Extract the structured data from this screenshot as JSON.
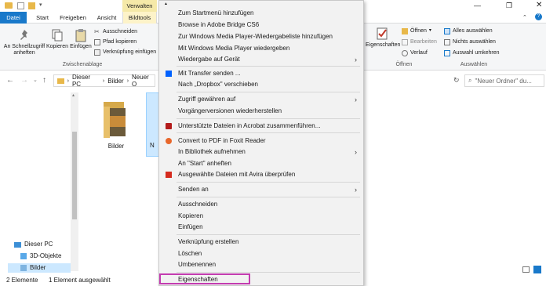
{
  "ribbon_tabs": {
    "datei": "Datei",
    "start": "Start",
    "freigeben": "Freigeben",
    "ansicht": "Ansicht",
    "verwalten": "Verwalten",
    "bildtools": "Bildtools"
  },
  "ribbon": {
    "pin_label": "An Schnellzugriff anheften",
    "copy_label": "Kopieren",
    "paste_label": "Einfügen",
    "cut_label": "Ausschneiden",
    "copypath_label": "Pfad kopieren",
    "pasteshortcut_label": "Verknüpfung einfügen",
    "clipboard_group": "Zwischenablage",
    "properties_label": "Eigenschaften",
    "open_label": "Öffnen",
    "edit_label": "Bearbeiten",
    "history_label": "Verlauf",
    "open_group": "Öffnen",
    "selectall_label": "Alles auswählen",
    "selectnone_label": "Nichts auswählen",
    "invert_label": "Auswahl umkehren",
    "select_group": "Auswählen"
  },
  "nav": {
    "breadcrumb": [
      "Dieser PC",
      "Bilder",
      "Neuer O"
    ],
    "search_placeholder": "\"Neuer Ordner\" du..."
  },
  "sidebar": {
    "items": [
      "Dieser PC",
      "3D-Objekte",
      "Bilder"
    ]
  },
  "content": {
    "items": [
      {
        "name": "Bilder"
      },
      {
        "name": "N"
      }
    ]
  },
  "status": {
    "count": "2 Elemente",
    "selected": "1 Element ausgewählt"
  },
  "context_menu": {
    "items": [
      {
        "label": "Zum Startmenü hinzufügen"
      },
      {
        "label": "Browse in Adobe Bridge CS6"
      },
      {
        "label": "Zur Windows Media Player-Wiedergabeliste hinzufügen"
      },
      {
        "label": "Mit Windows Media Player wiedergeben"
      },
      {
        "label": "Wiedergabe auf Gerät"
      },
      {
        "label": "Mit Transfer senden ..."
      },
      {
        "label": "Nach „Dropbox\" verschieben"
      },
      {
        "label": "Zugriff gewähren auf"
      },
      {
        "label": "Vorgängerversionen wiederherstellen"
      },
      {
        "label": "Unterstützte Dateien in Acrobat zusammenführen..."
      },
      {
        "label": "Convert to PDF in Foxit Reader"
      },
      {
        "label": "In Bibliothek aufnehmen"
      },
      {
        "label": "An \"Start\" anheften"
      },
      {
        "label": "Ausgewählte Dateien mit Avira überprüfen"
      },
      {
        "label": "Senden an"
      },
      {
        "label": "Ausschneiden"
      },
      {
        "label": "Kopieren"
      },
      {
        "label": "Einfügen"
      },
      {
        "label": "Verknüpfung erstellen"
      },
      {
        "label": "Löschen"
      },
      {
        "label": "Umbenennen"
      },
      {
        "label": "Eigenschaften"
      }
    ]
  },
  "colors": {
    "accent": "#1979ca",
    "highlight_box": "#c33cb0",
    "verwalten_tab": "#f5e9a8"
  }
}
